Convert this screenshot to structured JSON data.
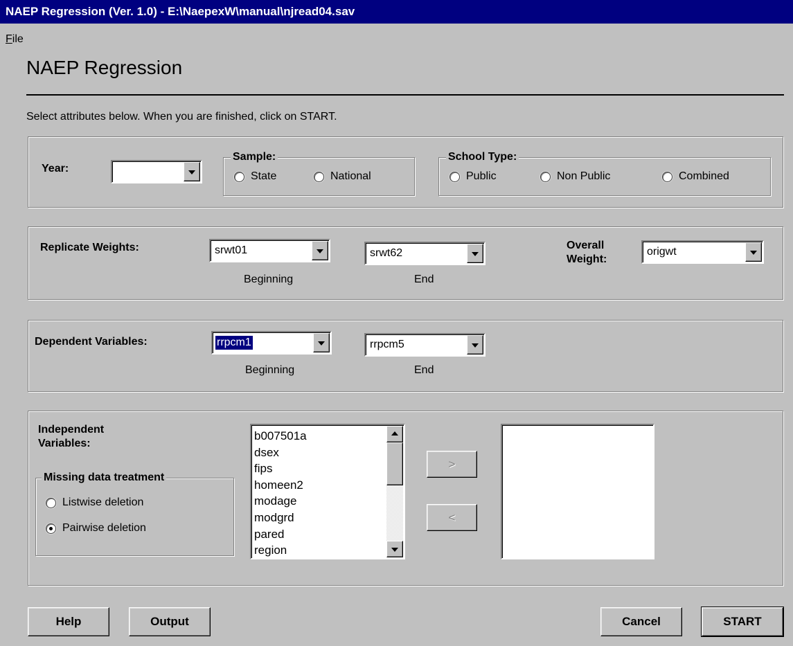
{
  "window": {
    "title": "NAEP Regression (Ver. 1.0) - E:\\NaepexW\\manual\\njread04.sav"
  },
  "menu": {
    "file_first": "F",
    "file_rest": "ile"
  },
  "header": {
    "title": "NAEP Regression",
    "instructions": "Select attributes below.  When you are finished, click on START."
  },
  "attributes": {
    "year_label": "Year:",
    "year_value": "",
    "sample": {
      "legend": "Sample:",
      "options": [
        "State",
        "National"
      ]
    },
    "school_type": {
      "legend": "School Type:",
      "options": [
        "Public",
        "Non Public",
        "Combined"
      ]
    }
  },
  "weights": {
    "label": "Replicate Weights:",
    "beginning_value": "srwt01",
    "end_value": "srwt62",
    "beginning_caption": "Beginning",
    "end_caption": "End",
    "overall_label_line1": "Overall",
    "overall_label_line2": "Weight:",
    "overall_value": "origwt"
  },
  "dependent": {
    "label": "Dependent Variables:",
    "beginning_value": "rrpcm1",
    "end_value": "rrpcm5",
    "beginning_caption": "Beginning",
    "end_caption": "End"
  },
  "independent": {
    "label_line1": "Independent",
    "label_line2": "Variables:",
    "available": [
      "b007501a",
      "dsex",
      "fips",
      "homeen2",
      "modage",
      "modgrd",
      "pared",
      "region"
    ],
    "selected": [],
    "add_label": ">",
    "remove_label": "<",
    "missing": {
      "legend": "Missing data treatment",
      "options": [
        "Listwise deletion",
        "Pairwise deletion"
      ],
      "selected": "Pairwise deletion"
    }
  },
  "buttons": {
    "help": "Help",
    "output": "Output",
    "cancel": "Cancel",
    "start": "START"
  }
}
